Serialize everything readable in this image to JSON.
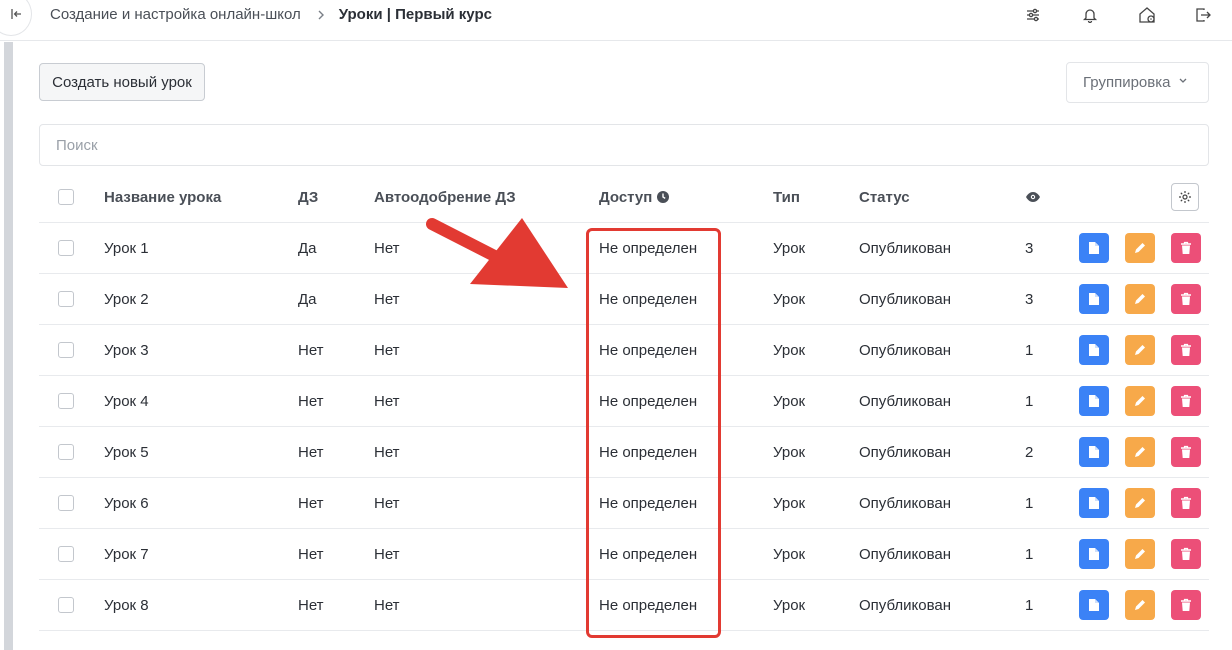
{
  "breadcrumb": {
    "parent": "Создание и настройка онлайн-школ",
    "current": "Уроки | Первый курс"
  },
  "toolbar": {
    "create_label": "Создать новый урок",
    "group_label": "Группировка"
  },
  "search": {
    "placeholder": "Поиск"
  },
  "table": {
    "columns": {
      "name": "Название урока",
      "hw": "ДЗ",
      "auto": "Автоодобрение ДЗ",
      "access": "Доступ",
      "type": "Тип",
      "status": "Статус"
    },
    "rows": [
      {
        "name": "Урок 1",
        "hw": "Да",
        "auto": "Нет",
        "access": "Не определен",
        "type": "Урок",
        "status": "Опубликован",
        "views": "3"
      },
      {
        "name": "Урок 2",
        "hw": "Да",
        "auto": "Нет",
        "access": "Не определен",
        "type": "Урок",
        "status": "Опубликован",
        "views": "3"
      },
      {
        "name": "Урок 3",
        "hw": "Нет",
        "auto": "Нет",
        "access": "Не определен",
        "type": "Урок",
        "status": "Опубликован",
        "views": "1"
      },
      {
        "name": "Урок 4",
        "hw": "Нет",
        "auto": "Нет",
        "access": "Не определен",
        "type": "Урок",
        "status": "Опубликован",
        "views": "1"
      },
      {
        "name": "Урок 5",
        "hw": "Нет",
        "auto": "Нет",
        "access": "Не определен",
        "type": "Урок",
        "status": "Опубликован",
        "views": "2"
      },
      {
        "name": "Урок 6",
        "hw": "Нет",
        "auto": "Нет",
        "access": "Не определен",
        "type": "Урок",
        "status": "Опубликован",
        "views": "1"
      },
      {
        "name": "Урок 7",
        "hw": "Нет",
        "auto": "Нет",
        "access": "Не определен",
        "type": "Урок",
        "status": "Опубликован",
        "views": "1"
      },
      {
        "name": "Урок 8",
        "hw": "Нет",
        "auto": "Нет",
        "access": "Не определен",
        "type": "Урок",
        "status": "Опубликован",
        "views": "1"
      }
    ]
  },
  "icons": {
    "top": [
      "sliders-icon",
      "bell-icon",
      "home-settings-icon",
      "logout-icon"
    ],
    "row_actions": [
      "document-icon",
      "pencil-icon",
      "trash-icon"
    ],
    "header_views": "eye-icon",
    "header_access_info": "clock-icon",
    "header_settings": "gear-icon"
  },
  "colors": {
    "view_button": "#3b82f6",
    "edit_button": "#f7a94a",
    "delete_button": "#ec4f78",
    "annotation": "#e23a32"
  }
}
